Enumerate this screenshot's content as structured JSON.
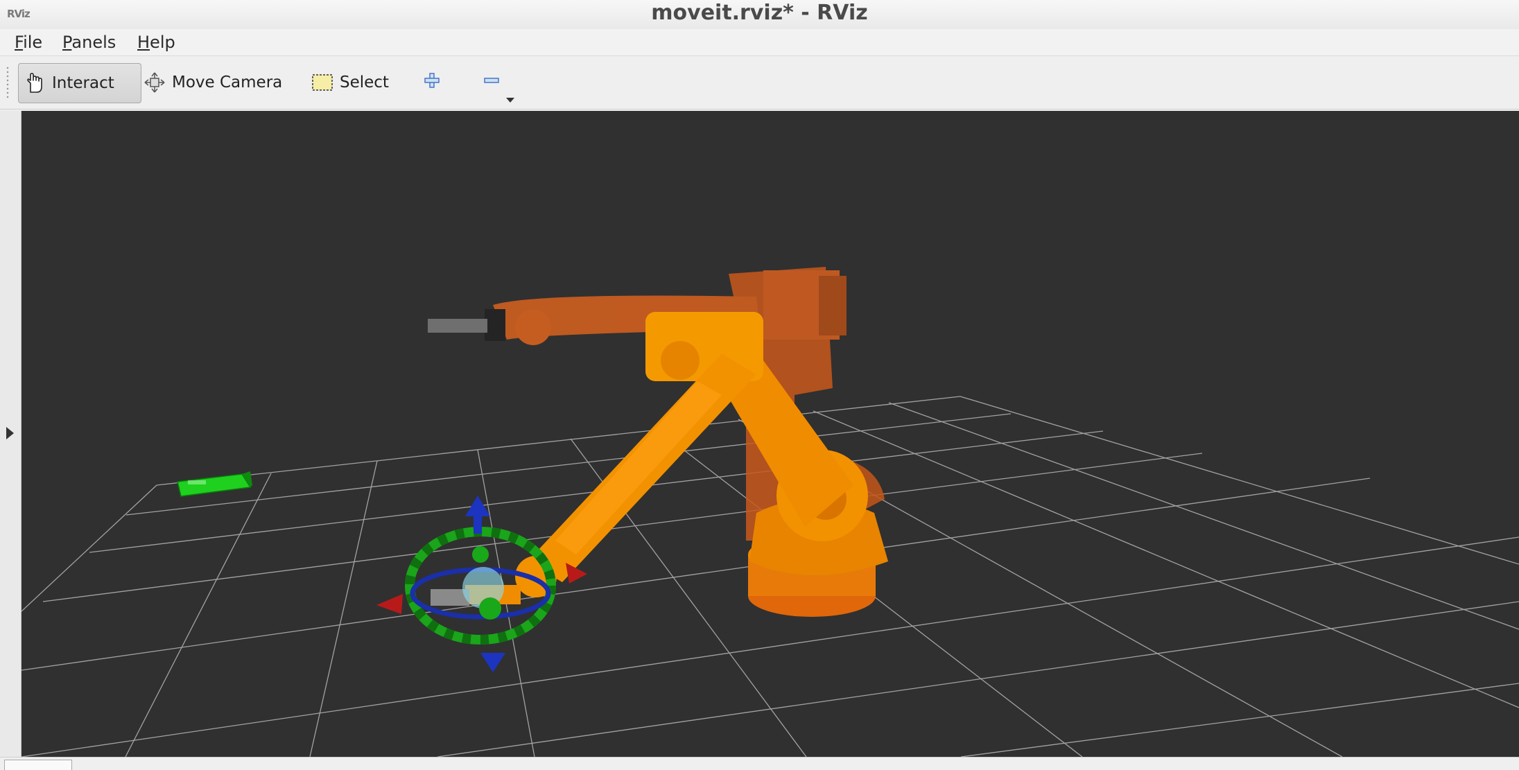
{
  "window": {
    "title": "moveit.rviz* - RViz",
    "app_icon_text": "RViz"
  },
  "menubar": {
    "items": [
      {
        "label": "File",
        "mnemonic": "F",
        "rest": "ile"
      },
      {
        "label": "Panels",
        "mnemonic": "P",
        "rest": "anels"
      },
      {
        "label": "Help",
        "mnemonic": "H",
        "rest": "elp"
      }
    ]
  },
  "toolbar": {
    "tools": [
      {
        "label": "Interact",
        "icon": "hand-icon",
        "active": true
      },
      {
        "label": "Move Camera",
        "icon": "move-camera-icon",
        "active": false
      },
      {
        "label": "Select",
        "icon": "select-box-icon",
        "active": false
      }
    ],
    "add_tool_icon": "plus-icon",
    "remove_tool_icon": "minus-icon"
  },
  "viewport": {
    "background": "#303030",
    "grid_color": "#a0a0a0",
    "robot_color": "#f08c00",
    "robot_goal_color": "#e06a10",
    "marker_ring_color": "#22aa22",
    "marker_blue": "#1a2fa8",
    "marker_red": "#b01818",
    "collision_object_color": "#22dd22"
  },
  "side_panel": {
    "toggle_icon": "expand-right-icon"
  }
}
